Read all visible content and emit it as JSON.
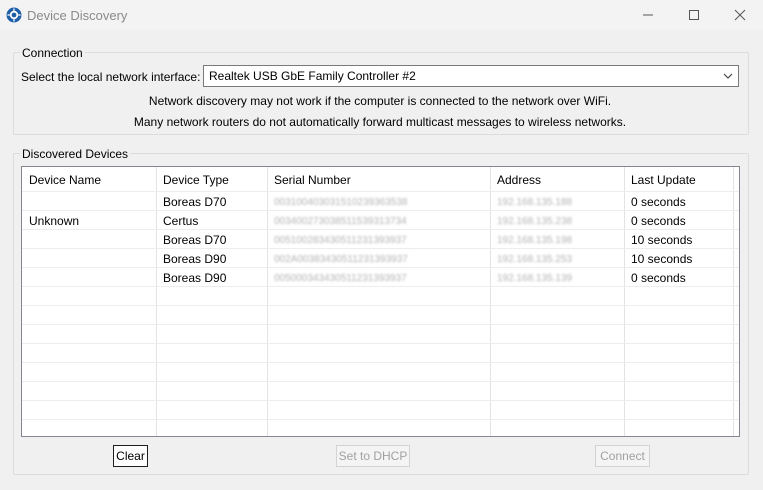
{
  "window": {
    "title": "Device Discovery"
  },
  "connection": {
    "group_label": "Connection",
    "interface_label": "Select the local network interface:",
    "interface_value": "Realtek USB GbE Family Controller #2",
    "note_line1": "Network discovery may not work if the computer is connected to the network over WiFi.",
    "note_line2": "Many network routers do not automatically forward multicast messages to wireless networks."
  },
  "devices": {
    "group_label": "Discovered Devices",
    "columns": [
      "Device Name",
      "Device Type",
      "Serial Number",
      "Address",
      "Last Update"
    ],
    "rows": [
      [
        "",
        "Boreas D70",
        "00310040303151023936353​8",
        "192.168.135.188",
        "0 seconds"
      ],
      [
        "Unknown",
        "Certus",
        "00340027303851153931373​4",
        "192.168.135.238",
        "0 seconds"
      ],
      [
        "",
        "Boreas D70",
        "00510028343051123139393​7",
        "192.168.135.198",
        "10 seconds"
      ],
      [
        "",
        "Boreas D90",
        "002A00383430511231393937",
        "192.168.135.253",
        "10 seconds"
      ],
      [
        "",
        "Boreas D90",
        "005000343430511231393937",
        "192.168.135.139",
        "0 seconds"
      ]
    ]
  },
  "buttons": {
    "clear": "Clear",
    "dhcp": "Set to DHCP",
    "connect": "Connect"
  }
}
